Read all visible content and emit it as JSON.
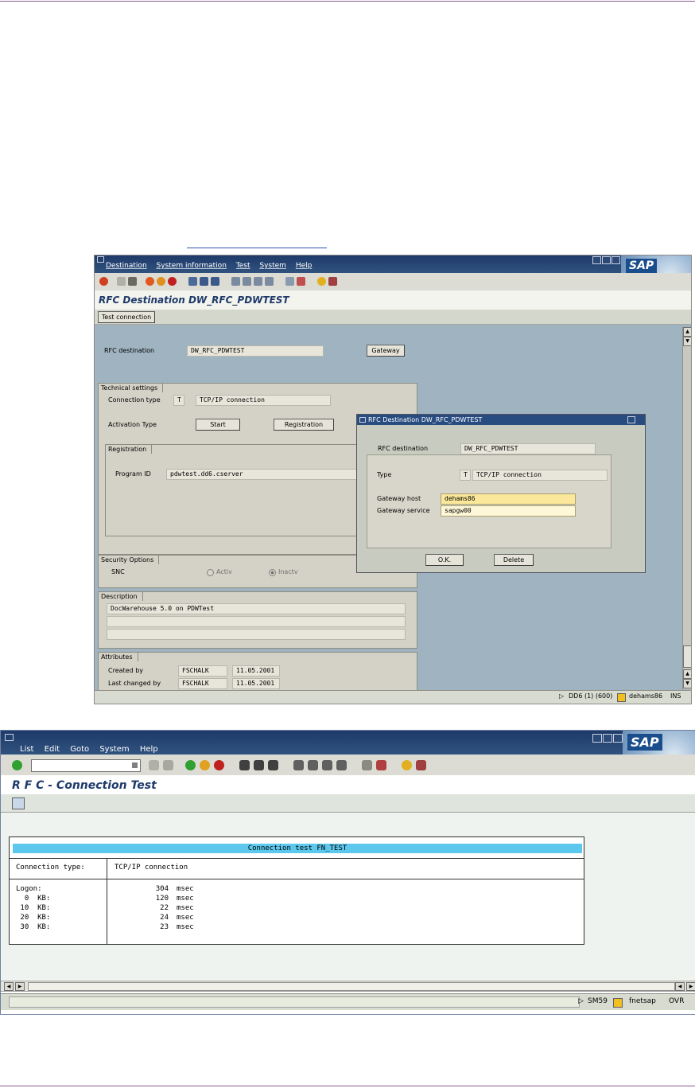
{
  "screen1": {
    "menu": [
      "Destination",
      "System information",
      "Test",
      "System",
      "Help"
    ],
    "logo": "SAP",
    "page_title": "RFC Destination DW_RFC_PDWTEST",
    "test_connection_label": "Test connection",
    "rfc_destination_label": "RFC destination",
    "rfc_destination_value": "DW_RFC_PDWTEST",
    "gateway_button": "Gateway",
    "technical_settings": {
      "title": "Technical settings",
      "connection_type_label": "Connection type",
      "connection_type_code": "T",
      "connection_type_value": "TCP/IP connection",
      "activation_type_label": "Activation Type",
      "start_button": "Start",
      "registration_button": "Registration",
      "registration_group_title": "Registration",
      "program_id_label": "Program ID",
      "program_id_value": "pdwtest.dd6.cserver"
    },
    "security": {
      "title": "Security Options",
      "snc_label": "SNC",
      "activ_label": "Activ",
      "inactv_label": "Inactv"
    },
    "description": {
      "title": "Description",
      "line1": "DocWarehouse 5.0 on PDWTest"
    },
    "attributes": {
      "title": "Attributes",
      "created_by_label": "Created by",
      "created_by_user": "FSCHALK",
      "created_by_date": "11.05.2001",
      "changed_by_label": "Last changed by",
      "changed_by_user": "FSCHALK",
      "changed_by_date": "11.05.2001"
    },
    "dialog": {
      "title": "RFC Destination DW_RFC_PDWTEST",
      "rfc_destination_label": "RFC destination",
      "rfc_destination_value": "DW_RFC_PDWTEST",
      "type_label": "Type",
      "type_code": "T",
      "type_value": "TCP/IP connection",
      "gateway_host_label": "Gateway host",
      "gateway_host_value": "dehams86",
      "gateway_service_label": "Gateway service",
      "gateway_service_value": "sapgw00",
      "ok_button": "O.K.",
      "delete_button": "Delete"
    },
    "status": {
      "system": "DD6 (1) (600)",
      "server": "dehams86",
      "mode": "INS"
    }
  },
  "screen2": {
    "menu": [
      "List",
      "Edit",
      "Goto",
      "System",
      "Help"
    ],
    "logo": "SAP",
    "page_title": "R F C - Connection Test",
    "result_header": "Connection test FN_TEST",
    "connection_type_label": "Connection type:",
    "connection_type_value": "TCP/IP connection",
    "rows": [
      {
        "label": "Logon:",
        "value": "304",
        "unit": "msec"
      },
      {
        "label": "  0  KB:",
        "value": "120",
        "unit": "msec"
      },
      {
        "label": " 10  KB:",
        "value": "22",
        "unit": "msec"
      },
      {
        "label": " 20  KB:",
        "value": "24",
        "unit": "msec"
      },
      {
        "label": " 30  KB:",
        "value": "23",
        "unit": "msec"
      }
    ],
    "status": {
      "transaction": "SM59",
      "server": "fnetsap",
      "mode": "OVR"
    }
  }
}
